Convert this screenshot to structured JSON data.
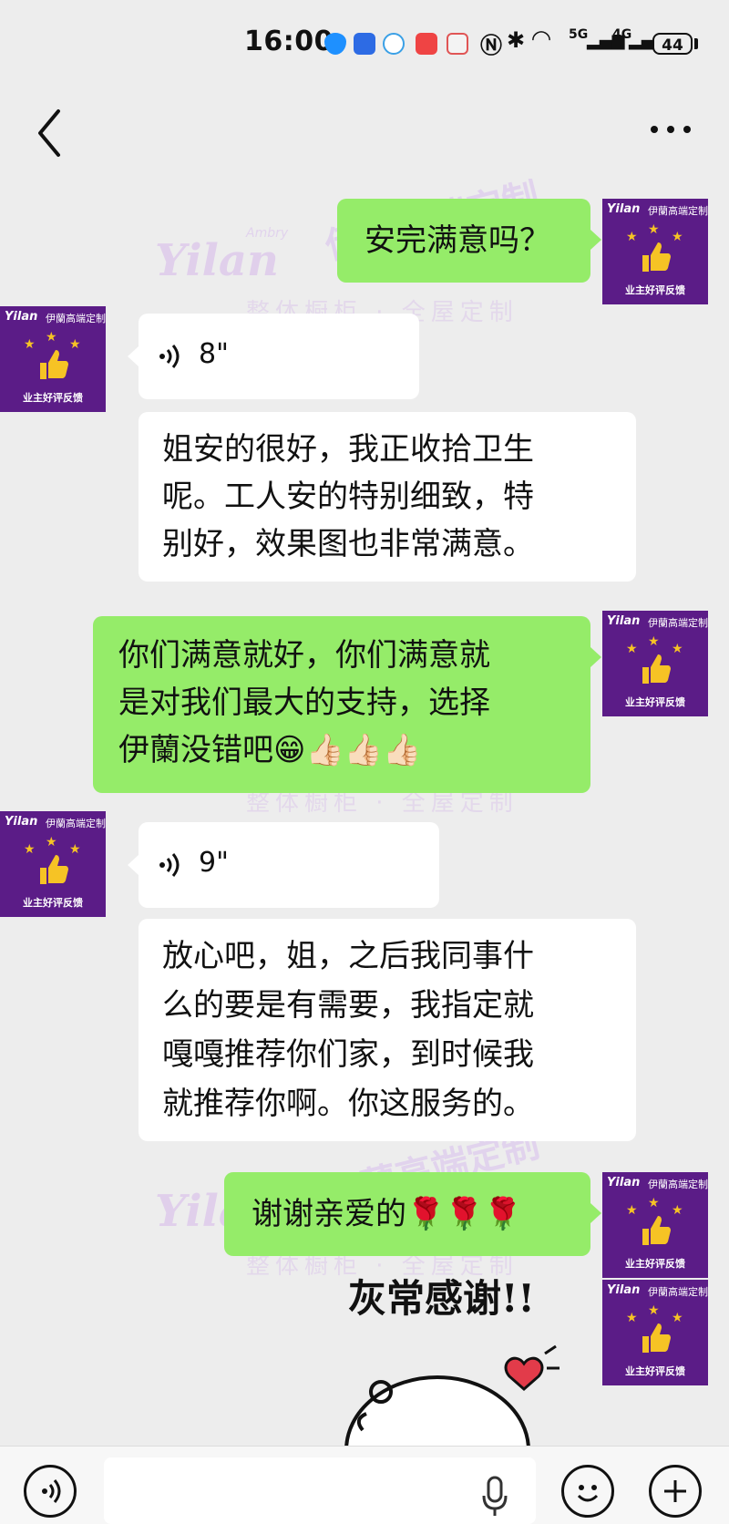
{
  "status_bar": {
    "time": "16:00",
    "network_5g": "5G",
    "network_4g": "4G",
    "battery": "44"
  },
  "navbar": {
    "back_icon": "chevron-left-icon",
    "more_icon": "ellipsis-icon"
  },
  "avatar": {
    "brand": "Yilan",
    "brand_cn": "伊蘭高端定制",
    "caption": "业主好评反馈"
  },
  "watermark": {
    "brand": "Yilan",
    "sub_brand": "Ambry",
    "tagline": "整体橱柜 · 全屋定制",
    "brand_cn": "伊蘭高端定制"
  },
  "messages": [
    {
      "side": "right",
      "type": "text",
      "text": "安完满意吗？"
    },
    {
      "side": "left",
      "type": "voice",
      "duration": "8\""
    },
    {
      "side": "left",
      "type": "text",
      "lines": [
        "姐安的很好，我正收拾卫生",
        "呢。工人安的特别细致，特",
        "别好，效果图也非常满意。"
      ]
    },
    {
      "side": "right",
      "type": "text",
      "lines": [
        "你们满意就好，你们满意就",
        "是对我们最大的支持，选择",
        "伊蘭没错吧😁👍🏻👍🏻👍🏻"
      ]
    },
    {
      "side": "left",
      "type": "voice",
      "duration": "9\""
    },
    {
      "side": "left",
      "type": "text",
      "lines": [
        "放心吧，姐，之后我同事什",
        "么的要是有需要，我指定就",
        "嘎嘎推荐你们家，到时候我",
        "就推荐你啊。你这服务的。"
      ]
    },
    {
      "side": "right",
      "type": "text",
      "text": "谢谢亲爱的🌹🌹🌹"
    },
    {
      "side": "right",
      "type": "sticker",
      "text": "灰常感谢!!"
    }
  ],
  "input_bar": {
    "voice_icon": "voice-mode-icon",
    "mic_icon": "microphone-icon",
    "emoji_icon": "emoji-icon",
    "plus_icon": "plus-icon",
    "value": ""
  },
  "colors": {
    "background": "#ededed",
    "bubble_green": "#95ec69",
    "bubble_white": "#ffffff",
    "avatar_purple": "#5b1c87",
    "star_gold": "#f6c325"
  }
}
